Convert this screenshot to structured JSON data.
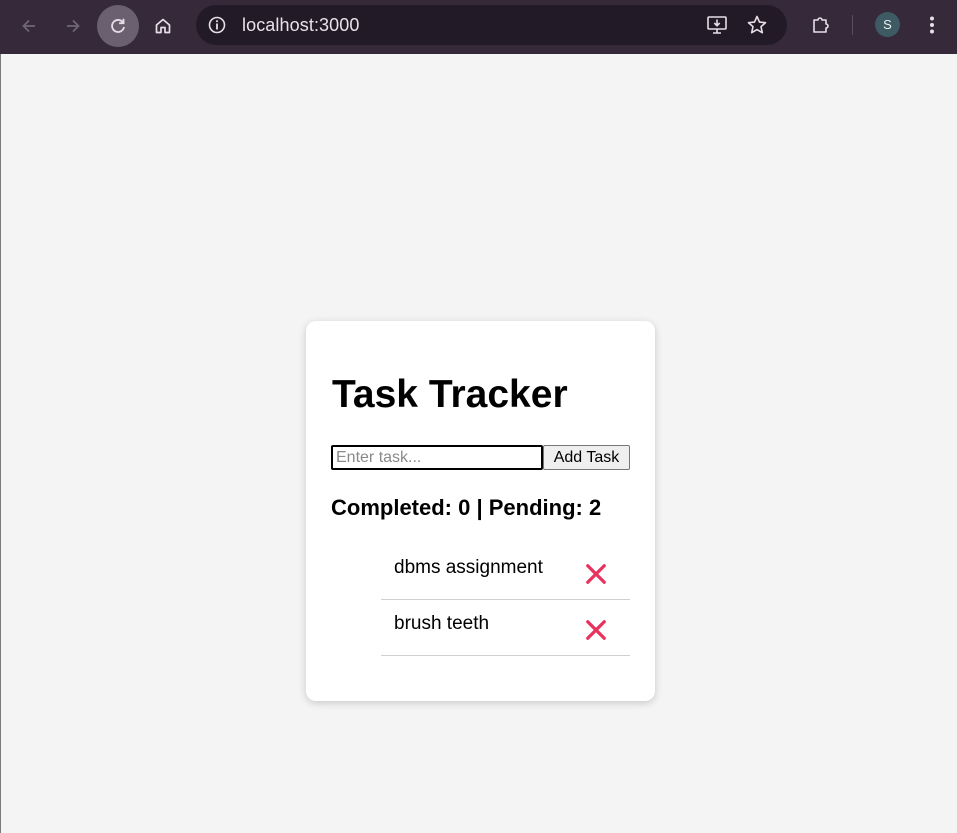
{
  "browser": {
    "url": "localhost:3000",
    "profile_initial": "S",
    "icons": {
      "back": "back-arrow-icon",
      "forward": "forward-arrow-icon",
      "reload": "reload-icon",
      "home": "home-icon",
      "site_info": "info-icon",
      "install": "install-app-icon",
      "bookmark": "star-icon",
      "extensions": "puzzle-icon",
      "menu": "kebab-menu-icon"
    }
  },
  "app": {
    "title": "Task Tracker",
    "input_placeholder": "Enter task...",
    "input_value": "",
    "add_button_label": "Add Task",
    "stats_text": "Completed: 0 | Pending: 2",
    "tasks": [
      {
        "text": "dbms assignment",
        "delete_icon": "close-x-icon"
      },
      {
        "text": "brush teeth",
        "delete_icon": "close-x-icon"
      }
    ]
  },
  "colors": {
    "toolbar": "#35293a",
    "delete_icon": "#e8335f",
    "page_background": "#f4f4f4",
    "card_background": "#ffffff"
  }
}
